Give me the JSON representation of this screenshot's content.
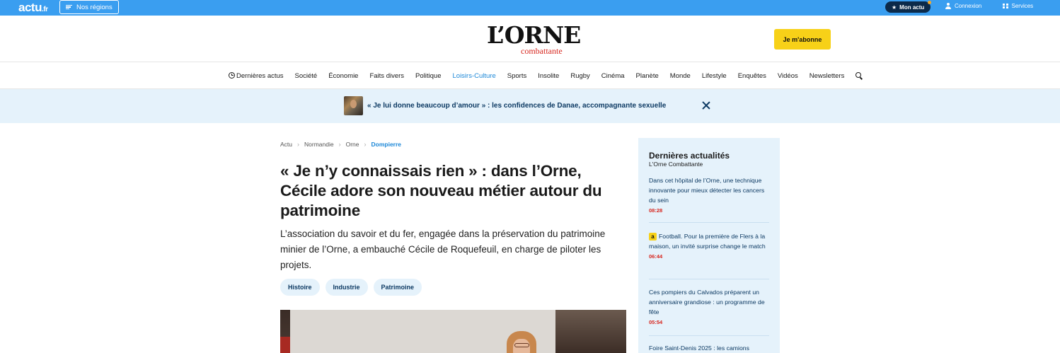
{
  "topbar": {
    "brand": "actu",
    "brand_suffix": ".fr",
    "regions_label": "Nos régions",
    "mon_actu_label": "Mon actu",
    "login_label": "Connexion",
    "services_label": "Services"
  },
  "header": {
    "logo_main": "L’ORNE",
    "logo_sub": "combattante",
    "subscribe_label": "Je m'abonne"
  },
  "nav": {
    "items": [
      "Dernières actus",
      "Société",
      "Économie",
      "Faits divers",
      "Politique",
      "Loisirs-Culture",
      "Sports",
      "Insolite",
      "Rugby",
      "Cinéma",
      "Planète",
      "Monde",
      "Lifestyle",
      "Enquêtes",
      "Vidéos",
      "Newsletters"
    ],
    "active_item": "Loisirs-Culture"
  },
  "banner": {
    "text": "« Je lui donne beaucoup d’amour » : les confidences de Danae, accompagnante sexuelle"
  },
  "breadcrumb": [
    "Actu",
    "Normandie",
    "Orne",
    "Dompierre"
  ],
  "article": {
    "headline": "« Je n’y connaissais rien » : dans l’Orne, Cécile adore son nouveau métier autour du patrimoine",
    "lead": "L’association du savoir et du fer, engagée dans la préservation du patrimoine minier de l’Orne, a embauché Cécile de Roquefeuil, en charge de piloter les projets.",
    "tags": [
      "Histoire",
      "Industrie",
      "Patrimoine"
    ]
  },
  "sidebar": {
    "title": "Dernières actualités",
    "subtitle": "L'Orne Combattante",
    "items": [
      {
        "text": "Dans cet hôpital de l’Orne, une technique innovante pour mieux détecter les cancers du sein",
        "time": "08:28",
        "premium": false
      },
      {
        "text": "Football. Pour la première de Flers à la maison, un invité surprise change le match",
        "time": "06:44",
        "premium": true,
        "premium_badge": "a"
      },
      {
        "text": "Ces pompiers du Calvados préparent un anniversaire grandiose : un programme de fête",
        "time": "05:54",
        "premium": false
      },
      {
        "text": "Foire Saint-Denis 2025 : les camions",
        "time": "",
        "premium": false
      }
    ]
  },
  "colors": {
    "topbar": "#3a9ef0",
    "accent_blue": "#1d88d8",
    "subscribe_yellow": "#f7d118",
    "banner_bg": "#e5f2fb",
    "time_red": "#d7261e",
    "navy": "#0d3a63"
  }
}
